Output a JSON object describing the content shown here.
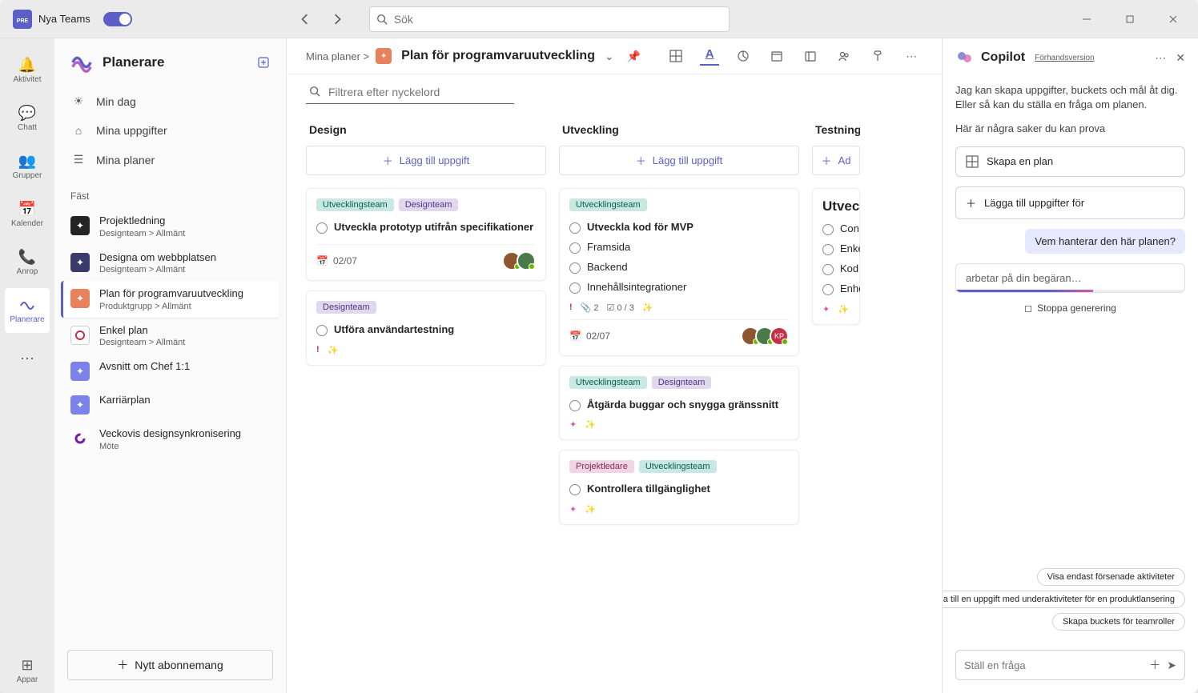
{
  "titlebar": {
    "app_name": "Nya Teams",
    "search_placeholder": "Sök"
  },
  "rail": [
    {
      "id": "activity",
      "label": "Aktivitet"
    },
    {
      "id": "chat",
      "label": "Chatt"
    },
    {
      "id": "teams",
      "label": "Grupper"
    },
    {
      "id": "calendar",
      "label": "Kalender"
    },
    {
      "id": "calls",
      "label": "Anrop"
    },
    {
      "id": "planner",
      "label": "Planerare",
      "active": true
    },
    {
      "id": "more",
      "label": ""
    },
    {
      "id": "apps",
      "label": "Appar"
    }
  ],
  "sidebar": {
    "title": "Planerare",
    "nav": [
      {
        "id": "myday",
        "label": "Min dag"
      },
      {
        "id": "mytasks",
        "label": "Mina uppgifter"
      },
      {
        "id": "myplans",
        "label": "Mina planer"
      }
    ],
    "pinned_label": "Fäst",
    "plans": [
      {
        "title": "Projektledning",
        "sub": "Designteam >   Allmänt",
        "icon_bg": "#242424",
        "icon_txt": "\\A"
      },
      {
        "title": "Designa om webbplatsen",
        "sub": "Designteam >   Allmänt",
        "icon_bg": "#3b3a6b"
      },
      {
        "title": "Plan för programvaruutveckling",
        "sub": "Produktgrupp >  Allmänt",
        "icon_bg": "#e8825d",
        "selected": true
      },
      {
        "title": "Enkel plan",
        "sub": "Designteam >   Allmänt",
        "icon_bg": "#ffffff",
        "ring": true
      },
      {
        "title": "Avsnitt om Chef 1:1",
        "sub": "",
        "icon_bg": "#7b83eb"
      },
      {
        "title": "Karriärplan",
        "sub": "",
        "icon_bg": "#7b83eb"
      },
      {
        "title": "Veckovis designsynkronisering",
        "sub": "Möte",
        "icon_bg": "#ffffff",
        "loop": true
      }
    ],
    "new_sub": "Nytt abonnemang"
  },
  "main": {
    "breadcrumb": "Mina planer >",
    "title": "Plan för programvaruutveckling",
    "filter_placeholder": "Filtrera efter nyckelord",
    "add_task_label": "Lägg till uppgift",
    "columns": [
      {
        "name": "Design",
        "cards": [
          {
            "tags": [
              {
                "t": "Utvecklingsteam",
                "c": "teal"
              },
              {
                "t": "Designteam",
                "c": "purple"
              }
            ],
            "tasks": [
              {
                "t": "Utveckla prototyp utifrån specifikationer",
                "bold": true
              }
            ],
            "date": "02/07",
            "avatars": 2
          },
          {
            "tags": [
              {
                "t": "Designteam",
                "c": "purple"
              }
            ],
            "tasks": [
              {
                "t": "Utföra användartestning",
                "bold": true
              }
            ],
            "priority": true,
            "sparkle": true
          }
        ]
      },
      {
        "name": "Utveckling",
        "cards": [
          {
            "tags": [
              {
                "t": "Utvecklingsteam",
                "c": "teal"
              }
            ],
            "tasks": [
              {
                "t": "Utveckla kod för MVP",
                "bold": true
              },
              {
                "t": "Framsida"
              },
              {
                "t": "Backend"
              },
              {
                "t": "Innehållsintegrationer"
              }
            ],
            "meta": {
              "priority": true,
              "attach": 2,
              "check": "0 / 3",
              "sparkle": true
            },
            "date": "02/07",
            "avatars": 3,
            "kp": true
          },
          {
            "tags": [
              {
                "t": "Utvecklingsteam",
                "c": "teal"
              },
              {
                "t": "Designteam",
                "c": "purple"
              }
            ],
            "tasks": [
              {
                "t": "Åtgärda buggar och snygga gränssnitt",
                "bold": true
              }
            ],
            "ai": true,
            "sparkle": true
          },
          {
            "tags": [
              {
                "t": "Projektledare",
                "c": "pink"
              },
              {
                "t": "Utvecklingsteam",
                "c": "teal"
              }
            ],
            "tasks": [
              {
                "t": "Kontrollera tillgänglighet",
                "bold": true
              }
            ],
            "ai": true,
            "sparkle": true
          }
        ]
      },
      {
        "name": "Testning",
        "add_label": "Ad",
        "cards": [
          {
            "title_row": "Utveckla/",
            "tasks": [
              {
                "t": "Con"
              },
              {
                "t": "Enkel"
              },
              {
                "t": "Kod"
              },
              {
                "t": "Enhet"
              }
            ],
            "ai": true,
            "sparkle": true
          }
        ]
      }
    ]
  },
  "copilot": {
    "title": "Copilot",
    "preview": "Förhandsversion",
    "intro": "Jag kan skapa uppgifter, buckets och mål åt dig. Eller så kan du ställa en fråga om planen.",
    "try_label": "Här är några saker du kan prova",
    "suggestions": [
      {
        "icon": "grid",
        "label": "Skapa en plan"
      },
      {
        "icon": "plus",
        "label": "Lägga till uppgifter för"
      }
    ],
    "user_msg": "Vem hanterar den här planen?",
    "working": "arbetar på din begäran…",
    "stop": "Stoppa generering",
    "chips": [
      "Visa endast försenade aktiviteter",
      "Lägga till en uppgift med underaktiviteter för en produktlansering",
      "Skapa buckets för teamroller"
    ],
    "ask_placeholder": "Ställ en fråga"
  }
}
